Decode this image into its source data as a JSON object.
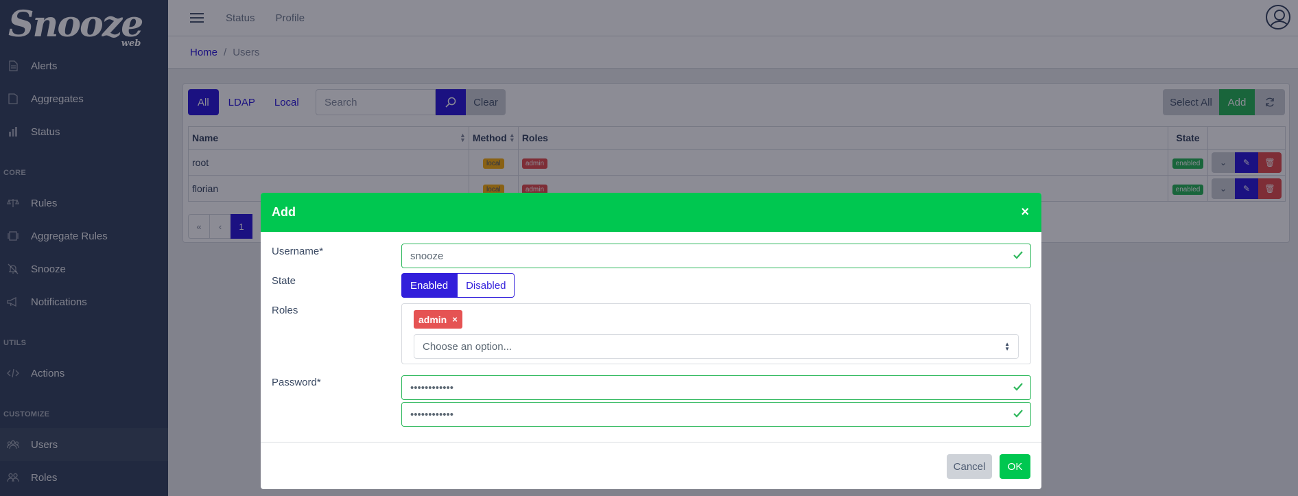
{
  "brand": {
    "name": "Snooze",
    "sub": "web"
  },
  "sidebar": {
    "items": [
      {
        "label": "Alerts",
        "icon": "file-icon"
      },
      {
        "label": "Aggregates",
        "icon": "document-icon"
      },
      {
        "label": "Status",
        "icon": "bar-chart-icon"
      }
    ],
    "sections": [
      {
        "title": "CORE",
        "items": [
          {
            "label": "Rules",
            "icon": "balance-scale-icon"
          },
          {
            "label": "Aggregate Rules",
            "icon": "layers-icon"
          },
          {
            "label": "Snooze",
            "icon": "bell-slash-icon"
          },
          {
            "label": "Notifications",
            "icon": "bullhorn-icon"
          }
        ]
      },
      {
        "title": "UTILS",
        "items": [
          {
            "label": "Actions",
            "icon": "code-icon"
          }
        ]
      },
      {
        "title": "CUSTOMIZE",
        "items": [
          {
            "label": "Users",
            "icon": "group-icon"
          },
          {
            "label": "Roles",
            "icon": "people-icon"
          }
        ]
      }
    ]
  },
  "header": {
    "links": [
      "Status",
      "Profile"
    ]
  },
  "breadcrumb": {
    "home": "Home",
    "current": "Users"
  },
  "toolbar": {
    "tabs": [
      "All",
      "LDAP",
      "Local"
    ],
    "search_placeholder": "Search",
    "clear": "Clear",
    "select_all": "Select All",
    "add": "Add"
  },
  "table": {
    "columns": [
      "Name",
      "Method",
      "Roles",
      "State"
    ],
    "rows": [
      {
        "name": "root",
        "method": "local",
        "role": "admin",
        "state": "enabled"
      },
      {
        "name": "florian",
        "method": "local",
        "role": "admin",
        "state": "enabled"
      }
    ]
  },
  "pagination": {
    "first": "«",
    "prev": "‹",
    "page": "1"
  },
  "modal": {
    "title": "Add",
    "close": "×",
    "username_label": "Username*",
    "username_value": "snooze",
    "state_label": "State",
    "state_enabled": "Enabled",
    "state_disabled": "Disabled",
    "roles_label": "Roles",
    "role_tag": "admin",
    "role_remove": "×",
    "roles_placeholder": "Choose an option...",
    "password_label": "Password*",
    "password_value": "••••••••••••",
    "password_confirm_value": "••••••••••••",
    "cancel": "Cancel",
    "ok": "OK"
  },
  "colors": {
    "primary": "#321fdb",
    "success": "#00c750",
    "danger": "#e55353",
    "warning": "#f9b115",
    "sidebar": "#3c4b64"
  }
}
